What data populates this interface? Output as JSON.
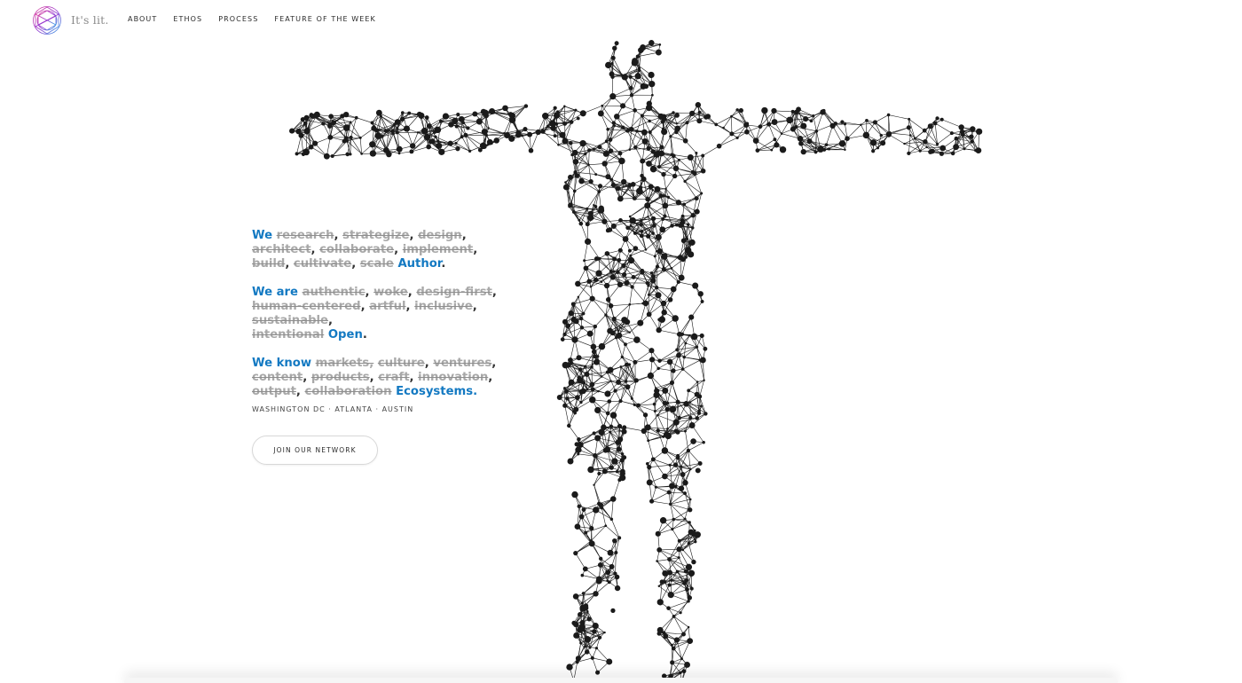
{
  "brand": {
    "name": "It's lit."
  },
  "nav": {
    "items": [
      {
        "label": "ABOUT"
      },
      {
        "label": "ETHOS"
      },
      {
        "label": "PROCESS"
      },
      {
        "label": "FEATURE OF THE WEEK"
      }
    ]
  },
  "copy": {
    "p1": {
      "lead": "We",
      "struck": [
        "research",
        "strategize",
        "design",
        "architect",
        "collaborate",
        "implement",
        "build",
        "cultivate",
        "scale"
      ],
      "final": "Author"
    },
    "p2": {
      "lead": "We are",
      "struck": [
        "authentic",
        "woke",
        "design-first",
        "human-centered",
        "artful",
        "inclusive",
        "sustainable",
        "intentional"
      ],
      "final": "Open"
    },
    "p3": {
      "lead": "We know",
      "struck": [
        "markets,",
        "culture",
        "ventures",
        "content",
        "products",
        "craft",
        "innovation",
        "output",
        "collaboration"
      ],
      "final": "Ecosystems."
    }
  },
  "cities": "WASHINGTON DC · ATLANTA · AUSTIN",
  "cta": {
    "label": "JOIN OUR NETWORK"
  },
  "colors": {
    "accent": "#1379c2",
    "struck": "#a8a8a8",
    "network": "#1a1a1a"
  },
  "icons": {
    "logo": "geodesic-circle-logo-icon"
  }
}
